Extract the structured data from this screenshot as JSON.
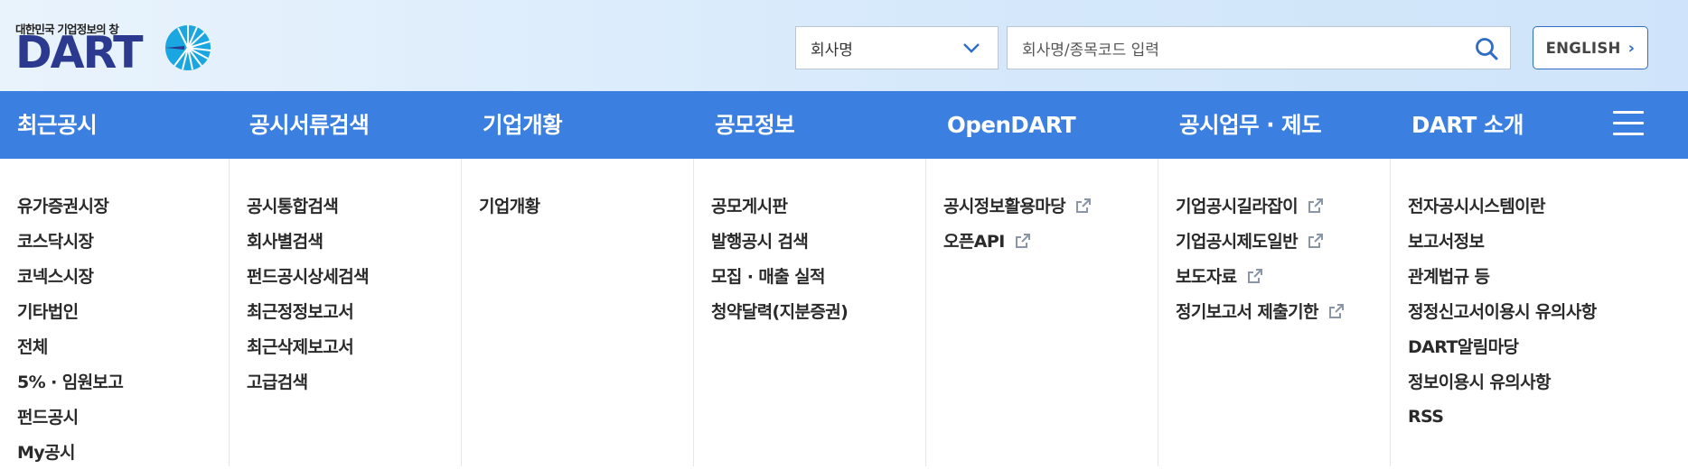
{
  "header": {
    "logo_tagline": "대한민국 기업정보의 창",
    "logo_word": "DART",
    "select_value": "회사명",
    "search_placeholder": "회사명/종목코드 입력",
    "english_label": "ENGLISH"
  },
  "nav": {
    "items": [
      {
        "label": "최근공시"
      },
      {
        "label": "공시서류검색"
      },
      {
        "label": "기업개황"
      },
      {
        "label": "공모정보"
      },
      {
        "label": "OpenDART"
      },
      {
        "label": "공시업무 · 제도"
      },
      {
        "label": "DART 소개"
      }
    ]
  },
  "menu": {
    "columns": [
      {
        "items": [
          {
            "label": "유가증권시장",
            "external": false
          },
          {
            "label": "코스닥시장",
            "external": false
          },
          {
            "label": "코넥스시장",
            "external": false
          },
          {
            "label": "기타법인",
            "external": false
          },
          {
            "label": "전체",
            "external": false
          },
          {
            "label": "5% · 임원보고",
            "external": false
          },
          {
            "label": "펀드공시",
            "external": false
          },
          {
            "label": "My공시",
            "external": false
          }
        ]
      },
      {
        "items": [
          {
            "label": "공시통합검색",
            "external": false
          },
          {
            "label": "회사별검색",
            "external": false
          },
          {
            "label": "펀드공시상세검색",
            "external": false
          },
          {
            "label": "최근정정보고서",
            "external": false
          },
          {
            "label": "최근삭제보고서",
            "external": false
          },
          {
            "label": "고급검색",
            "external": false
          }
        ]
      },
      {
        "items": [
          {
            "label": "기업개황",
            "external": false
          }
        ]
      },
      {
        "items": [
          {
            "label": "공모게시판",
            "external": false
          },
          {
            "label": "발행공시 검색",
            "external": false
          },
          {
            "label": "모집 · 매출 실적",
            "external": false
          },
          {
            "label": "청약달력(지분증권)",
            "external": false
          }
        ]
      },
      {
        "items": [
          {
            "label": "공시정보활용마당",
            "external": true
          },
          {
            "label": "오픈API",
            "external": true
          }
        ]
      },
      {
        "items": [
          {
            "label": "기업공시길라잡이",
            "external": true
          },
          {
            "label": "기업공시제도일반",
            "external": true
          },
          {
            "label": "보도자료",
            "external": true
          },
          {
            "label": "정기보고서 제출기한",
            "external": true
          }
        ]
      },
      {
        "items": [
          {
            "label": "전자공시시스템이란",
            "external": false
          },
          {
            "label": "보고서정보",
            "external": false
          },
          {
            "label": "관계법규 등",
            "external": false
          },
          {
            "label": "정정신고서이용시 유의사항",
            "external": false
          },
          {
            "label": "DART알림마당",
            "external": false
          },
          {
            "label": "정보이용시 유의사항",
            "external": false
          },
          {
            "label": "RSS",
            "external": false
          }
        ]
      }
    ]
  },
  "colors": {
    "nav_bg": "#3b7fe1",
    "logo_navy": "#2b3a8e",
    "logo_cyan": "#1aa6e0",
    "accent": "#2f6dc4"
  }
}
